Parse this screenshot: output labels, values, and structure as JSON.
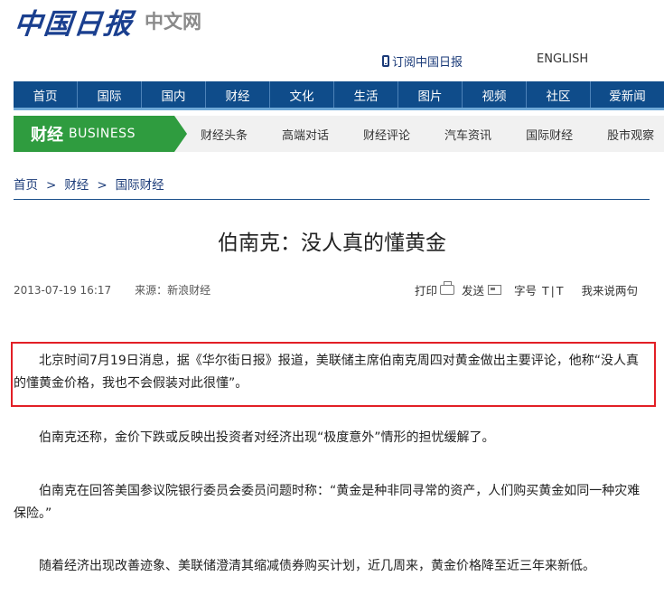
{
  "logo": {
    "text": "中国日报",
    "sub": "中文网"
  },
  "top_links": {
    "subscribe": "订阅中国日报",
    "english": "ENGLISH"
  },
  "main_nav": [
    "首页",
    "国际",
    "国内",
    "财经",
    "文化",
    "生活",
    "图片",
    "视频",
    "社区",
    "爱新闻"
  ],
  "section": {
    "cn": "财经",
    "en": "BUSINESS"
  },
  "sub_nav": [
    "财经头条",
    "高端对话",
    "财经评论",
    "汽车资讯",
    "国际财经",
    "股市观察"
  ],
  "breadcrumb": [
    "首页",
    "财经",
    "国际财经"
  ],
  "breadcrumb_sep": ">",
  "article": {
    "title": "伯南克：没人真的懂黄金",
    "datetime": "2013-07-19 16:17",
    "source": "来源：新浪财经",
    "paragraphs": [
      "北京时间7月19日消息，据《华尔街日报》报道，美联储主席伯南克周四对黄金做出主要评论，他称“没人真的懂黄金价格，我也不会假装对此很懂”。",
      "伯南克还称，金价下跌或反映出投资者对经济出现“极度意外”情形的担忧缓解了。",
      "伯南克在回答美国参议院银行委员会委员问题时称：“黄金是种非同寻常的资产，人们购买黄金如同一种灾难保险。”",
      "随着经济出现改善迹象、美联储澄清其缩减债券购买计划，近几周来，黄金价格降至近三年来新低。"
    ]
  },
  "tools": {
    "print": "打印",
    "send": "发送",
    "font_size": "字号",
    "font_large": "T",
    "font_sep": "|",
    "font_small": "T",
    "comment": "我来说两句"
  },
  "colors": {
    "nav_blue": "#0f4c8a",
    "section_green": "#2f9c3f",
    "highlight_red": "#e21f26",
    "link_blue": "#1a3a78"
  }
}
